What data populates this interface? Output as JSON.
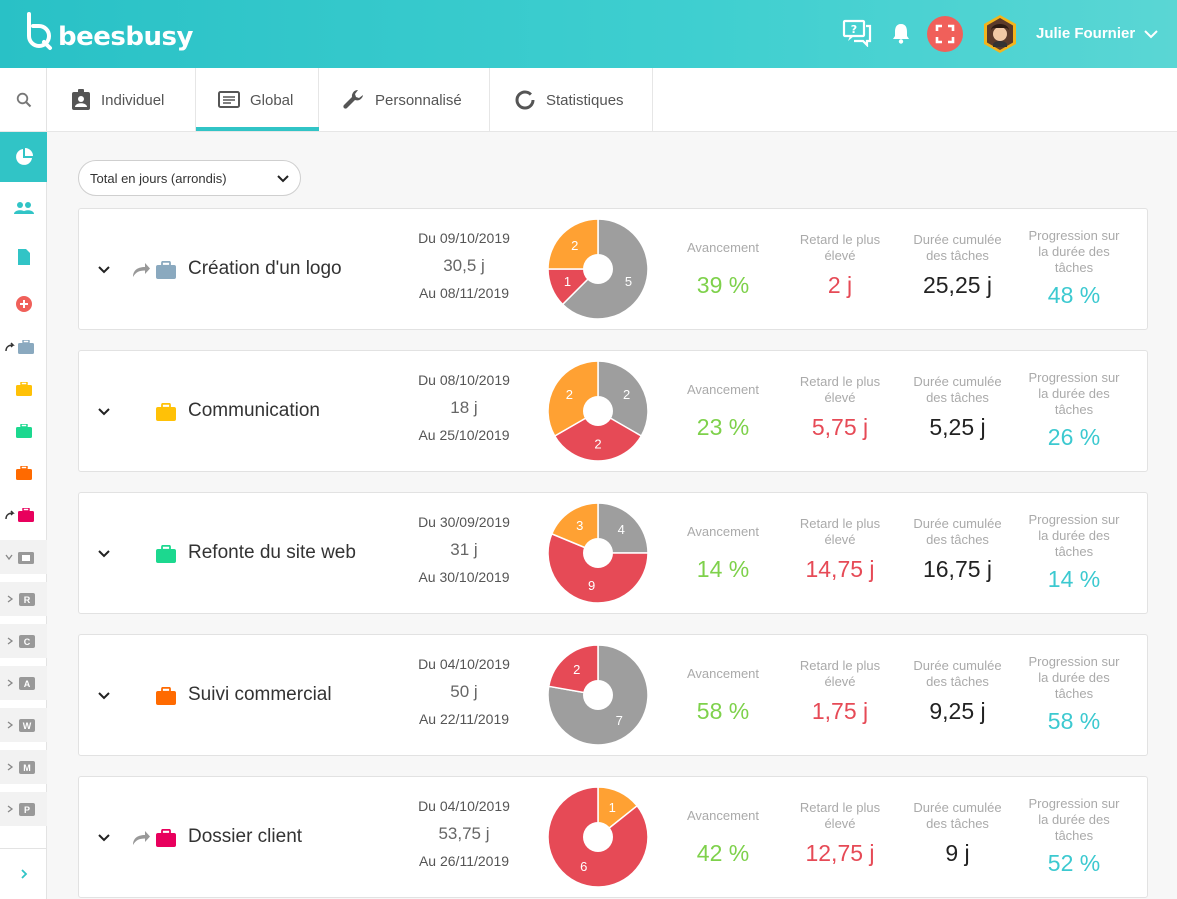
{
  "app": {
    "brand": "beesbusy",
    "user_name": "Julie Fournier"
  },
  "icons": {
    "search": "search-icon",
    "notifications": "bell-icon",
    "help": "chat-question-icon",
    "fullscreen": "fullscreen-icon",
    "expand": "chevron-down-icon",
    "linked": "share-arrow-icon",
    "project": "briefcase-icon"
  },
  "colors": {
    "accent": "#31c4c6",
    "fullscreen_bg": "#f0605a",
    "green": "#7ed14b",
    "red": "#e64a56",
    "teal": "#3cc9d0",
    "pie_grey": "#9e9e9e",
    "pie_orange": "#ffa133",
    "pie_red": "#e64a56"
  },
  "tabs": [
    {
      "label": "Individuel"
    },
    {
      "label": "Global"
    },
    {
      "label": "Personnalisé"
    },
    {
      "label": "Statistiques"
    }
  ],
  "selector": {
    "value": "Total en jours (arrondis)"
  },
  "sidebar": {
    "sub_letters": [
      "R",
      "C",
      "A",
      "W",
      "M",
      "P"
    ],
    "project_colors": [
      "#8aa9bf",
      "#ffc107",
      "#1cd88f",
      "#ff6a00",
      "#e8005d"
    ]
  },
  "labels": {
    "avancement": "Avancement",
    "retard_line1": "Retard le plus",
    "retard_line2": "élevé",
    "duree_line1": "Durée cumulée",
    "duree_line2": "des tâches",
    "progression_line1": "Progression sur",
    "progression_line2": "la durée des",
    "progression_line3": "tâches"
  },
  "projects": [
    {
      "name": "Création d'un logo",
      "color": "#8aa9bf",
      "linked": true,
      "date_from": "Du 09/10/2019",
      "duration": "30,5 j",
      "date_to": "Au 08/11/2019",
      "pie": [
        {
          "label": "5",
          "value": 5,
          "color": "#9e9e9e"
        },
        {
          "label": "1",
          "value": 1,
          "color": "#e64a56"
        },
        {
          "label": "2",
          "value": 2,
          "color": "#ffa133"
        }
      ],
      "avancement": "39 %",
      "retard": "2 j",
      "duree": "25,25 j",
      "progression": "48 %"
    },
    {
      "name": "Communication",
      "color": "#ffc107",
      "linked": false,
      "date_from": "Du 08/10/2019",
      "duration": "18 j",
      "date_to": "Au 25/10/2019",
      "pie": [
        {
          "label": "2",
          "value": 2,
          "color": "#9e9e9e"
        },
        {
          "label": "2",
          "value": 2,
          "color": "#e64a56"
        },
        {
          "label": "2",
          "value": 2,
          "color": "#ffa133"
        }
      ],
      "avancement": "23 %",
      "retard": "5,75 j",
      "duree": "5,25 j",
      "progression": "26 %"
    },
    {
      "name": "Refonte du site web",
      "color": "#1cd88f",
      "linked": false,
      "date_from": "Du 30/09/2019",
      "duration": "31 j",
      "date_to": "Au 30/10/2019",
      "pie": [
        {
          "label": "4",
          "value": 4,
          "color": "#9e9e9e"
        },
        {
          "label": "9",
          "value": 9,
          "color": "#e64a56"
        },
        {
          "label": "3",
          "value": 3,
          "color": "#ffa133"
        }
      ],
      "avancement": "14 %",
      "retard": "14,75 j",
      "duree": "16,75 j",
      "progression": "14 %"
    },
    {
      "name": "Suivi commercial",
      "color": "#ff6a00",
      "linked": false,
      "date_from": "Du 04/10/2019",
      "duration": "50 j",
      "date_to": "Au 22/11/2019",
      "pie": [
        {
          "label": "7",
          "value": 7,
          "color": "#9e9e9e"
        },
        {
          "label": "2",
          "value": 2,
          "color": "#e64a56"
        }
      ],
      "avancement": "58 %",
      "retard": "1,75 j",
      "duree": "9,25 j",
      "progression": "58 %"
    },
    {
      "name": "Dossier client",
      "color": "#e8005d",
      "linked": true,
      "date_from": "Du 04/10/2019",
      "duration": "53,75 j",
      "date_to": "Au 26/11/2019",
      "pie": [
        {
          "label": "1",
          "value": 1,
          "color": "#ffa133"
        },
        {
          "label": "6",
          "value": 6,
          "color": "#e64a56"
        }
      ],
      "avancement": "42 %",
      "retard": "12,75 j",
      "duree": "9 j",
      "progression": "52 %"
    }
  ]
}
